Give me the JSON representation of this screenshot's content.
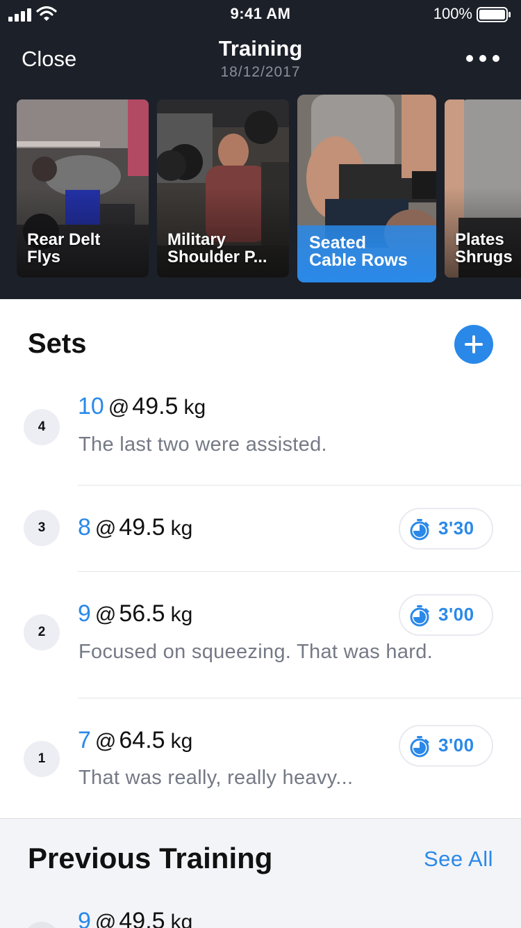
{
  "status_bar": {
    "time": "9:41 AM",
    "battery": "100%"
  },
  "nav": {
    "close_label": "Close",
    "title": "Training",
    "date": "18/12/2017"
  },
  "exercises": [
    {
      "label": "Rear Delt\nFlys",
      "active": false
    },
    {
      "label": "Military\nShoulder P...",
      "active": false
    },
    {
      "label": "Seated\nCable Rows",
      "active": true
    },
    {
      "label": "Plates\nShrugs",
      "active": false
    }
  ],
  "sets_section": {
    "title": "Sets",
    "sets": [
      {
        "number": "4",
        "reps": "10",
        "at": "@",
        "weight": "49.5",
        "unit": "kg",
        "note": "The last two were assisted.",
        "rest": ""
      },
      {
        "number": "3",
        "reps": "8",
        "at": "@",
        "weight": "49.5",
        "unit": "kg",
        "note": "",
        "rest": "3'30"
      },
      {
        "number": "2",
        "reps": "9",
        "at": "@",
        "weight": "56.5",
        "unit": "kg",
        "note": "Focused on squeezing. That was hard.",
        "rest": "3'00"
      },
      {
        "number": "1",
        "reps": "7",
        "at": "@",
        "weight": "64.5",
        "unit": "kg",
        "note": "That was really, really heavy...",
        "rest": "3'00"
      }
    ]
  },
  "previous_training": {
    "title": "Previous Training",
    "see_all_label": "See All",
    "first_set": {
      "reps": "9",
      "at": "@",
      "weight": "49.5",
      "unit": "kg"
    }
  },
  "colors": {
    "accent": "#2a89e8",
    "header_bg": "#1c2029",
    "muted_text": "#747985"
  },
  "icons": {
    "add": "plus-icon",
    "rest": "stopwatch-icon",
    "more": "ellipsis-icon"
  }
}
